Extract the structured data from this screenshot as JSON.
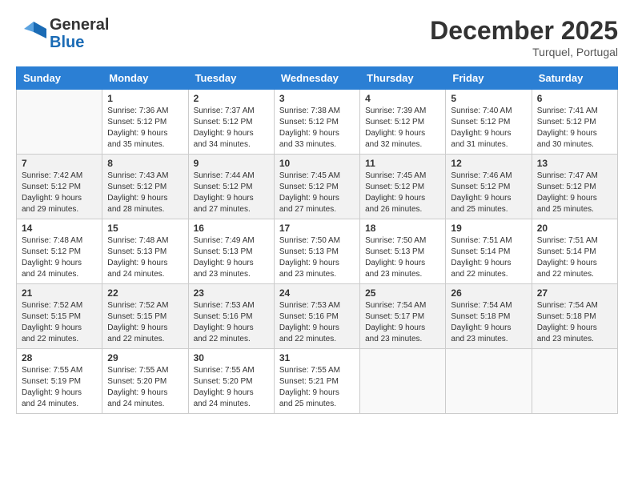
{
  "header": {
    "logo_line1": "General",
    "logo_line2": "Blue",
    "month_title": "December 2025",
    "location": "Turquel, Portugal"
  },
  "weekdays": [
    "Sunday",
    "Monday",
    "Tuesday",
    "Wednesday",
    "Thursday",
    "Friday",
    "Saturday"
  ],
  "weeks": [
    [
      {
        "day": "",
        "info": ""
      },
      {
        "day": "1",
        "info": "Sunrise: 7:36 AM\nSunset: 5:12 PM\nDaylight: 9 hours\nand 35 minutes."
      },
      {
        "day": "2",
        "info": "Sunrise: 7:37 AM\nSunset: 5:12 PM\nDaylight: 9 hours\nand 34 minutes."
      },
      {
        "day": "3",
        "info": "Sunrise: 7:38 AM\nSunset: 5:12 PM\nDaylight: 9 hours\nand 33 minutes."
      },
      {
        "day": "4",
        "info": "Sunrise: 7:39 AM\nSunset: 5:12 PM\nDaylight: 9 hours\nand 32 minutes."
      },
      {
        "day": "5",
        "info": "Sunrise: 7:40 AM\nSunset: 5:12 PM\nDaylight: 9 hours\nand 31 minutes."
      },
      {
        "day": "6",
        "info": "Sunrise: 7:41 AM\nSunset: 5:12 PM\nDaylight: 9 hours\nand 30 minutes."
      }
    ],
    [
      {
        "day": "7",
        "info": "Sunrise: 7:42 AM\nSunset: 5:12 PM\nDaylight: 9 hours\nand 29 minutes."
      },
      {
        "day": "8",
        "info": "Sunrise: 7:43 AM\nSunset: 5:12 PM\nDaylight: 9 hours\nand 28 minutes."
      },
      {
        "day": "9",
        "info": "Sunrise: 7:44 AM\nSunset: 5:12 PM\nDaylight: 9 hours\nand 27 minutes."
      },
      {
        "day": "10",
        "info": "Sunrise: 7:45 AM\nSunset: 5:12 PM\nDaylight: 9 hours\nand 27 minutes."
      },
      {
        "day": "11",
        "info": "Sunrise: 7:45 AM\nSunset: 5:12 PM\nDaylight: 9 hours\nand 26 minutes."
      },
      {
        "day": "12",
        "info": "Sunrise: 7:46 AM\nSunset: 5:12 PM\nDaylight: 9 hours\nand 25 minutes."
      },
      {
        "day": "13",
        "info": "Sunrise: 7:47 AM\nSunset: 5:12 PM\nDaylight: 9 hours\nand 25 minutes."
      }
    ],
    [
      {
        "day": "14",
        "info": "Sunrise: 7:48 AM\nSunset: 5:12 PM\nDaylight: 9 hours\nand 24 minutes."
      },
      {
        "day": "15",
        "info": "Sunrise: 7:48 AM\nSunset: 5:13 PM\nDaylight: 9 hours\nand 24 minutes."
      },
      {
        "day": "16",
        "info": "Sunrise: 7:49 AM\nSunset: 5:13 PM\nDaylight: 9 hours\nand 23 minutes."
      },
      {
        "day": "17",
        "info": "Sunrise: 7:50 AM\nSunset: 5:13 PM\nDaylight: 9 hours\nand 23 minutes."
      },
      {
        "day": "18",
        "info": "Sunrise: 7:50 AM\nSunset: 5:13 PM\nDaylight: 9 hours\nand 23 minutes."
      },
      {
        "day": "19",
        "info": "Sunrise: 7:51 AM\nSunset: 5:14 PM\nDaylight: 9 hours\nand 22 minutes."
      },
      {
        "day": "20",
        "info": "Sunrise: 7:51 AM\nSunset: 5:14 PM\nDaylight: 9 hours\nand 22 minutes."
      }
    ],
    [
      {
        "day": "21",
        "info": "Sunrise: 7:52 AM\nSunset: 5:15 PM\nDaylight: 9 hours\nand 22 minutes."
      },
      {
        "day": "22",
        "info": "Sunrise: 7:52 AM\nSunset: 5:15 PM\nDaylight: 9 hours\nand 22 minutes."
      },
      {
        "day": "23",
        "info": "Sunrise: 7:53 AM\nSunset: 5:16 PM\nDaylight: 9 hours\nand 22 minutes."
      },
      {
        "day": "24",
        "info": "Sunrise: 7:53 AM\nSunset: 5:16 PM\nDaylight: 9 hours\nand 22 minutes."
      },
      {
        "day": "25",
        "info": "Sunrise: 7:54 AM\nSunset: 5:17 PM\nDaylight: 9 hours\nand 23 minutes."
      },
      {
        "day": "26",
        "info": "Sunrise: 7:54 AM\nSunset: 5:18 PM\nDaylight: 9 hours\nand 23 minutes."
      },
      {
        "day": "27",
        "info": "Sunrise: 7:54 AM\nSunset: 5:18 PM\nDaylight: 9 hours\nand 23 minutes."
      }
    ],
    [
      {
        "day": "28",
        "info": "Sunrise: 7:55 AM\nSunset: 5:19 PM\nDaylight: 9 hours\nand 24 minutes."
      },
      {
        "day": "29",
        "info": "Sunrise: 7:55 AM\nSunset: 5:20 PM\nDaylight: 9 hours\nand 24 minutes."
      },
      {
        "day": "30",
        "info": "Sunrise: 7:55 AM\nSunset: 5:20 PM\nDaylight: 9 hours\nand 24 minutes."
      },
      {
        "day": "31",
        "info": "Sunrise: 7:55 AM\nSunset: 5:21 PM\nDaylight: 9 hours\nand 25 minutes."
      },
      {
        "day": "",
        "info": ""
      },
      {
        "day": "",
        "info": ""
      },
      {
        "day": "",
        "info": ""
      }
    ]
  ]
}
